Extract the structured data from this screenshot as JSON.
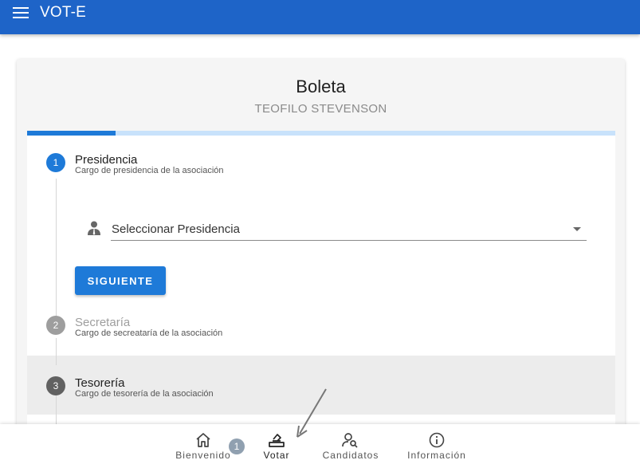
{
  "app": {
    "title": "VOT-E"
  },
  "ballot": {
    "title": "Boleta",
    "voter_name": "TEOFILO STEVENSON",
    "progress": 0.15
  },
  "steps": [
    {
      "number": "1",
      "title": "Presidencia",
      "subtitle": "Cargo de presidencia de la asociación",
      "state": "active",
      "color": "#1e7ad8"
    },
    {
      "number": "2",
      "title": "Secretaría",
      "subtitle": "Cargo de secreataría de la asociación",
      "state": "pending",
      "color": "#9e9e9e"
    },
    {
      "number": "3",
      "title": "Tesorería",
      "subtitle": "Cargo de tesorería de la asociación",
      "state": "hover",
      "color": "#616161"
    }
  ],
  "select": {
    "placeholder": "Seleccionar Presidencia",
    "icon": "person-tie-icon"
  },
  "buttons": {
    "next": "SIGUIENTE"
  },
  "bottom_nav": {
    "items": [
      {
        "label": "Bienvenido",
        "icon": "home-icon"
      },
      {
        "label": "Votar",
        "icon": "ballot-box-icon",
        "active": true
      },
      {
        "label": "Candidatos",
        "icon": "person-search-icon"
      },
      {
        "label": "Información",
        "icon": "info-icon"
      }
    ],
    "badge": "1"
  },
  "colors": {
    "primary": "#1e64c8",
    "accent": "#1e7ad8",
    "progress_track": "#c8e2fb"
  }
}
